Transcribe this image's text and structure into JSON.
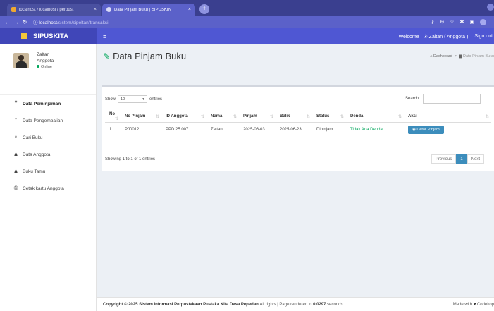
{
  "browser": {
    "tabs": [
      {
        "title": "localhost / localhost / perpust",
        "active": false
      },
      {
        "title": "Data Pinjam Buku | SIPUSKIN",
        "active": true
      }
    ],
    "url_host": "localhost",
    "url_path": "/sistem/sipeltan/transaksi"
  },
  "header": {
    "brand": "SIPUSKITA",
    "welcome": "Welcome , ☉ Zaltan ( Anggota )",
    "signout": "Sign out"
  },
  "user": {
    "name": "Zaltan",
    "role": "Anggota",
    "status": "Online"
  },
  "sidebar": {
    "items": [
      {
        "label": "Data Peminjaman",
        "icon": "upload-icon",
        "glyph": "⤒",
        "active": true
      },
      {
        "label": "Data Pengembalian",
        "icon": "upload-icon",
        "glyph": "⤒",
        "active": false
      },
      {
        "label": "Cari Buku",
        "icon": "search-icon",
        "glyph": "⌕",
        "active": false
      },
      {
        "label": "Data Anggota",
        "icon": "user-icon",
        "glyph": "♟",
        "active": false
      },
      {
        "label": "Buku Tamu",
        "icon": "user-icon",
        "glyph": "♟",
        "active": false
      },
      {
        "label": "Cetak kartu Anggota",
        "icon": "print-icon",
        "glyph": "⎙",
        "active": false
      }
    ]
  },
  "page": {
    "title": "Data Pinjam Buku",
    "breadcrumb_home": "Dashboard",
    "breadcrumb_current": "Data Pinjam Buku"
  },
  "table_controls": {
    "show_label": "Show",
    "entries_value": "10",
    "entries_label": "entries",
    "search_label": "Search:",
    "showing_text": "Showing 1 to 1 of 1 entries",
    "prev": "Previous",
    "page": "1",
    "next": "Next"
  },
  "table": {
    "columns": [
      "No",
      "No Pinjam",
      "ID Anggota",
      "Nama",
      "Pinjam",
      "Balik",
      "Status",
      "Denda",
      "Aksi"
    ],
    "rows": [
      {
        "no": "1",
        "no_pinjam": "PJ0012",
        "id_anggota": "PPD.25.007",
        "nama": "Zaltan",
        "pinjam": "2025-06-03",
        "balik": "2025-06-23",
        "status": "Dipinjam",
        "denda": "Tidak Ada Denda",
        "aksi": "Detail Pinjam"
      }
    ]
  },
  "footer": {
    "copyright_prefix": "Copyright © 2025",
    "org": "Sistem Informasi Perpustakaan Pustaka Kita Desa Pepedan",
    "rights": "All rights | Page rendered in",
    "time": "0.0297",
    "seconds": "seconds.",
    "made_with": "Made with",
    "made_by": "Codekop"
  },
  "colors": {
    "header": "#4f57d3",
    "brand_bg": "#4046b8",
    "accent_green": "#00a65a",
    "button_blue": "#3c8dbc"
  }
}
